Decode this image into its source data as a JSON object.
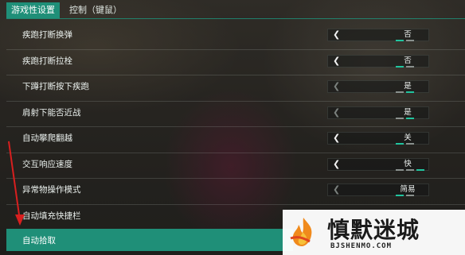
{
  "tabs": [
    {
      "label": "游戏性设置",
      "active": true
    },
    {
      "label": "控制（键鼠）",
      "active": false
    }
  ],
  "settings": [
    {
      "label": "疾跑打断换弹",
      "value": "否",
      "enabled": true
    },
    {
      "label": "疾跑打断拉栓",
      "value": "否",
      "enabled": true
    },
    {
      "label": "下蹲打断按下疾跑",
      "value": "是",
      "enabled": false
    },
    {
      "label": "肩射下能否近战",
      "value": "是",
      "enabled": false
    },
    {
      "label": "自动攀爬翻越",
      "value": "关",
      "enabled": true
    },
    {
      "label": "交互响应速度",
      "value": "快",
      "enabled": true
    },
    {
      "label": "异常物操作模式",
      "value": "简易",
      "enabled": false
    },
    {
      "label": "自动填充快捷栏",
      "value": "",
      "enabled": true
    }
  ],
  "highlight_row": {
    "label": "自动拾取"
  },
  "accent_color": "#1f8f78",
  "annotation_color": "#d81f1f",
  "watermark": {
    "title": "慎默迷城",
    "subtitle": "BJSHENMO.COM"
  }
}
